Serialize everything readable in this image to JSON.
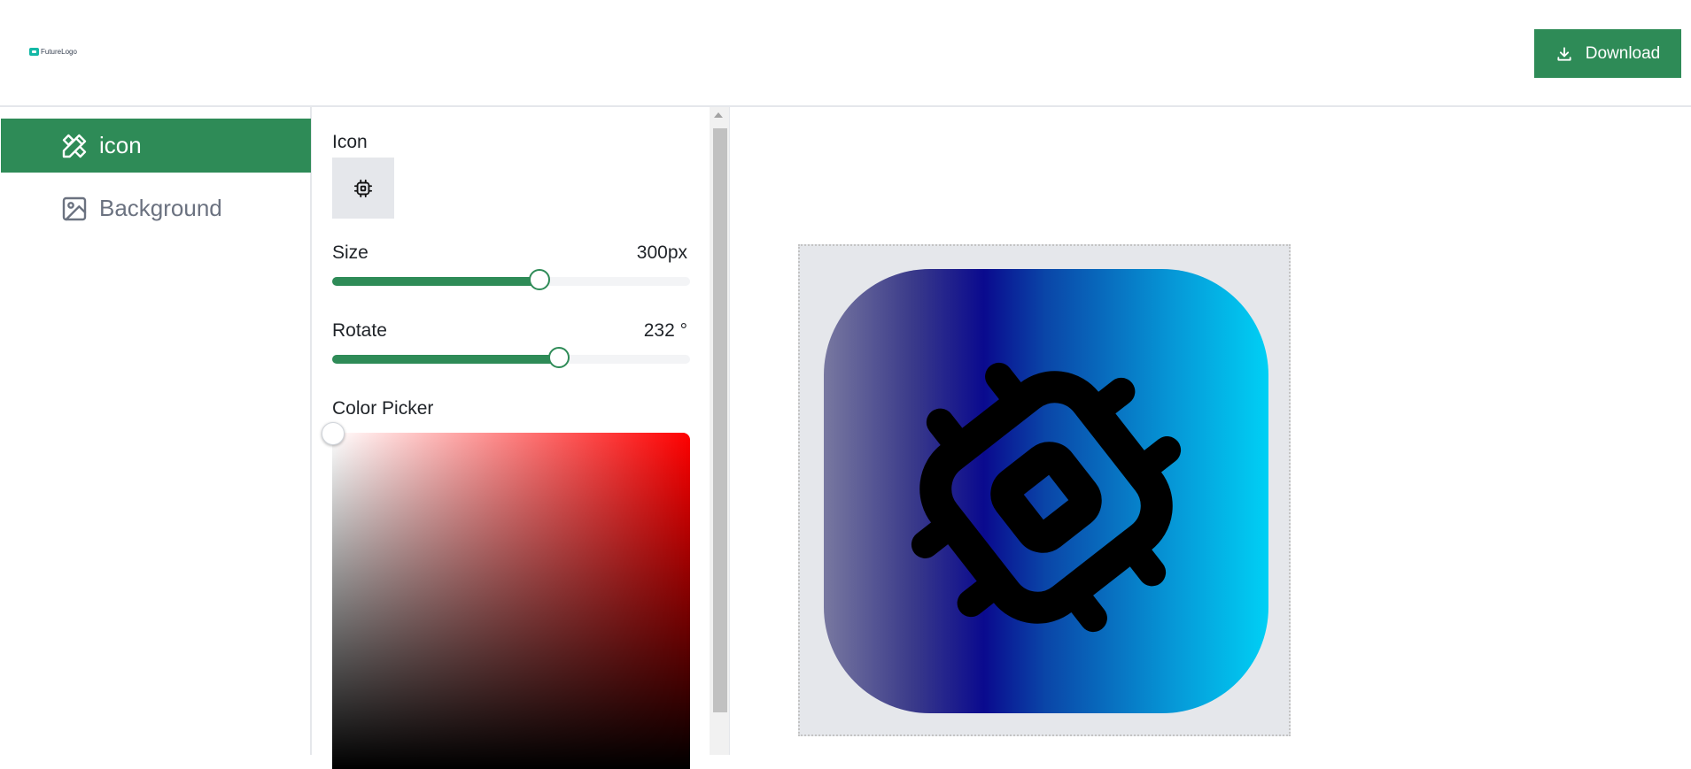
{
  "header": {
    "logo_text": "FutureLogo",
    "download_label": "Download"
  },
  "sidebar": {
    "items": [
      {
        "label": "icon",
        "icon": "pencil-ruler-icon",
        "active": true
      },
      {
        "label": "Background",
        "icon": "image-icon",
        "active": false
      }
    ]
  },
  "panel": {
    "icon_label": "Icon",
    "selected_icon": "cpu-icon",
    "size": {
      "label": "Size",
      "value_text": "300px",
      "fraction": 0.58
    },
    "rotate": {
      "label": "Rotate",
      "value_text": "232 °",
      "fraction": 0.634
    },
    "color_picker_label": "Color Picker"
  },
  "colors": {
    "accent": "#2e8b57",
    "gradient_stops": [
      "#7878a0",
      "#0a0a8e",
      "#00d0f5"
    ],
    "icon_stroke": "#000000"
  }
}
